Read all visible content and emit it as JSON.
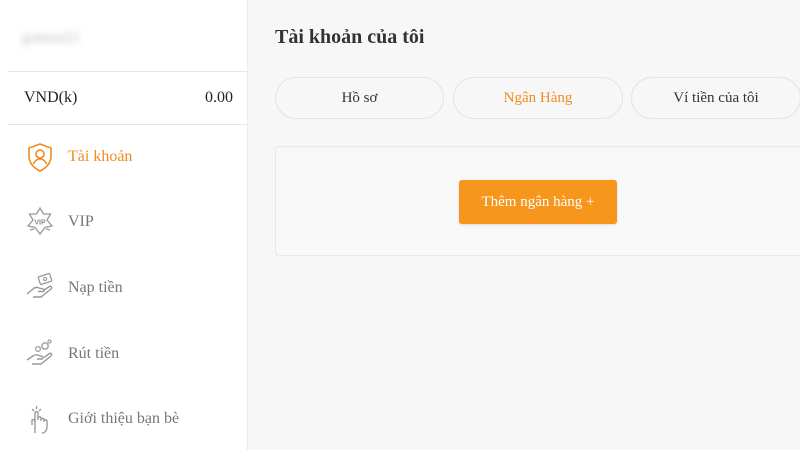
{
  "sidebar": {
    "username": "gotmai23",
    "balance": {
      "label": "VND(k)",
      "value": "0.00"
    },
    "items": [
      {
        "label": "Tài khoản",
        "icon": "account-shield-icon",
        "active": true
      },
      {
        "label": "VIP",
        "icon": "vip-badge-icon"
      },
      {
        "label": "Nạp tiền",
        "icon": "deposit-hand-icon"
      },
      {
        "label": "Rút tiền",
        "icon": "withdraw-hand-icon"
      },
      {
        "label": "Giới thiệu bạn bè",
        "icon": "refer-friends-icon"
      }
    ]
  },
  "main": {
    "title": "Tài khoản của tôi",
    "tabs": [
      {
        "label": "Hồ sơ"
      },
      {
        "label": "Ngân Hàng",
        "active": true
      },
      {
        "label": "Ví tiền của tôi"
      }
    ],
    "add_bank_label": "Thêm ngân hàng +"
  },
  "colors": {
    "accent": "#f28b1c",
    "button": "#f7961d",
    "text": "#333333",
    "muted": "#777777"
  }
}
